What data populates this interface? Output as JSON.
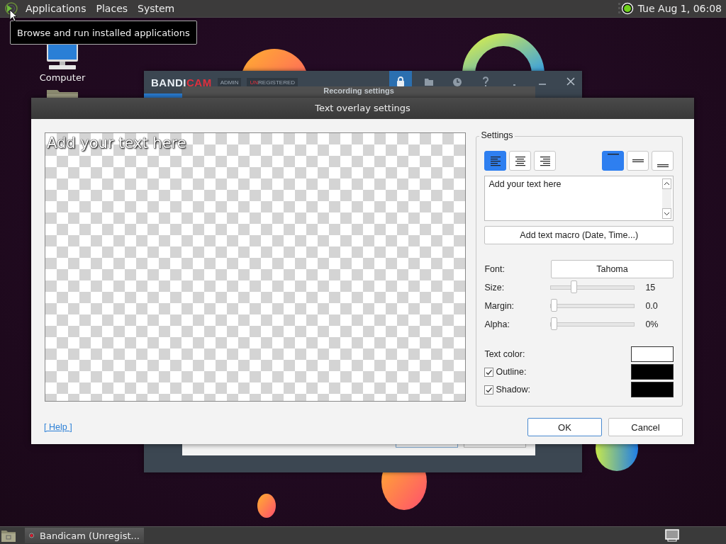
{
  "top_panel": {
    "menus": [
      "Applications",
      "Places",
      "System"
    ],
    "clock": "Tue Aug  1, 06:08"
  },
  "tooltip": "Browse and run installed applications",
  "desktop_icons": [
    {
      "kind": "computer",
      "label": "Computer"
    },
    {
      "kind": "folder"
    }
  ],
  "background_window": {
    "logo_left": "BANDI",
    "logo_right": "CAM",
    "user_badge": "ADMIN",
    "license_badge": {
      "accent": "UN",
      "rest": "REGISTERED"
    },
    "sheet_title": "Recording settings",
    "toolbar": [
      {
        "kind": "lock",
        "selected": true
      },
      {
        "kind": "folder",
        "selected": false
      },
      {
        "kind": "clock",
        "selected": false
      },
      {
        "kind": "help",
        "selected": false
      },
      {
        "kind": "dash",
        "selected": false
      },
      {
        "kind": "minimize",
        "selected": false
      },
      {
        "kind": "close",
        "selected": false
      }
    ]
  },
  "dialog": {
    "title": "Text overlay settings",
    "preview_text": "Add your text here",
    "group_title": "Settings",
    "h_align": [
      {
        "kind": "left",
        "selected": true
      },
      {
        "kind": "center",
        "selected": false
      },
      {
        "kind": "right",
        "selected": false
      }
    ],
    "v_align": [
      {
        "kind": "top",
        "selected": true
      },
      {
        "kind": "middle",
        "selected": false
      },
      {
        "kind": "bottom",
        "selected": false
      }
    ],
    "text_value": "Add your text here",
    "macro_button": "Add text macro (Date, Time...)",
    "font_label": "Font:",
    "font_value": "Tahoma",
    "sliders": [
      {
        "label": "Size:",
        "level": 0.26,
        "reading": "15"
      },
      {
        "label": "Margin:",
        "level": 0,
        "reading": "0.0"
      },
      {
        "label": "Alpha:",
        "level": 0,
        "reading": "0%"
      }
    ],
    "colors": [
      {
        "kind": "plain",
        "label": "Text color:",
        "color": "#ffffff"
      },
      {
        "kind": "check",
        "label": "Outline:",
        "checked": true,
        "color": "#000000"
      },
      {
        "kind": "check",
        "label": "Shadow:",
        "checked": true,
        "color": "#000000"
      }
    ],
    "help_link": "[ Help ]",
    "buttons": [
      {
        "label": "OK",
        "kind": "default"
      },
      {
        "label": "Cancel",
        "kind": "normal"
      }
    ]
  },
  "taskbar": {
    "tasks": [
      {
        "label": "Bandicam (Unregist...",
        "selected": true
      }
    ]
  }
}
